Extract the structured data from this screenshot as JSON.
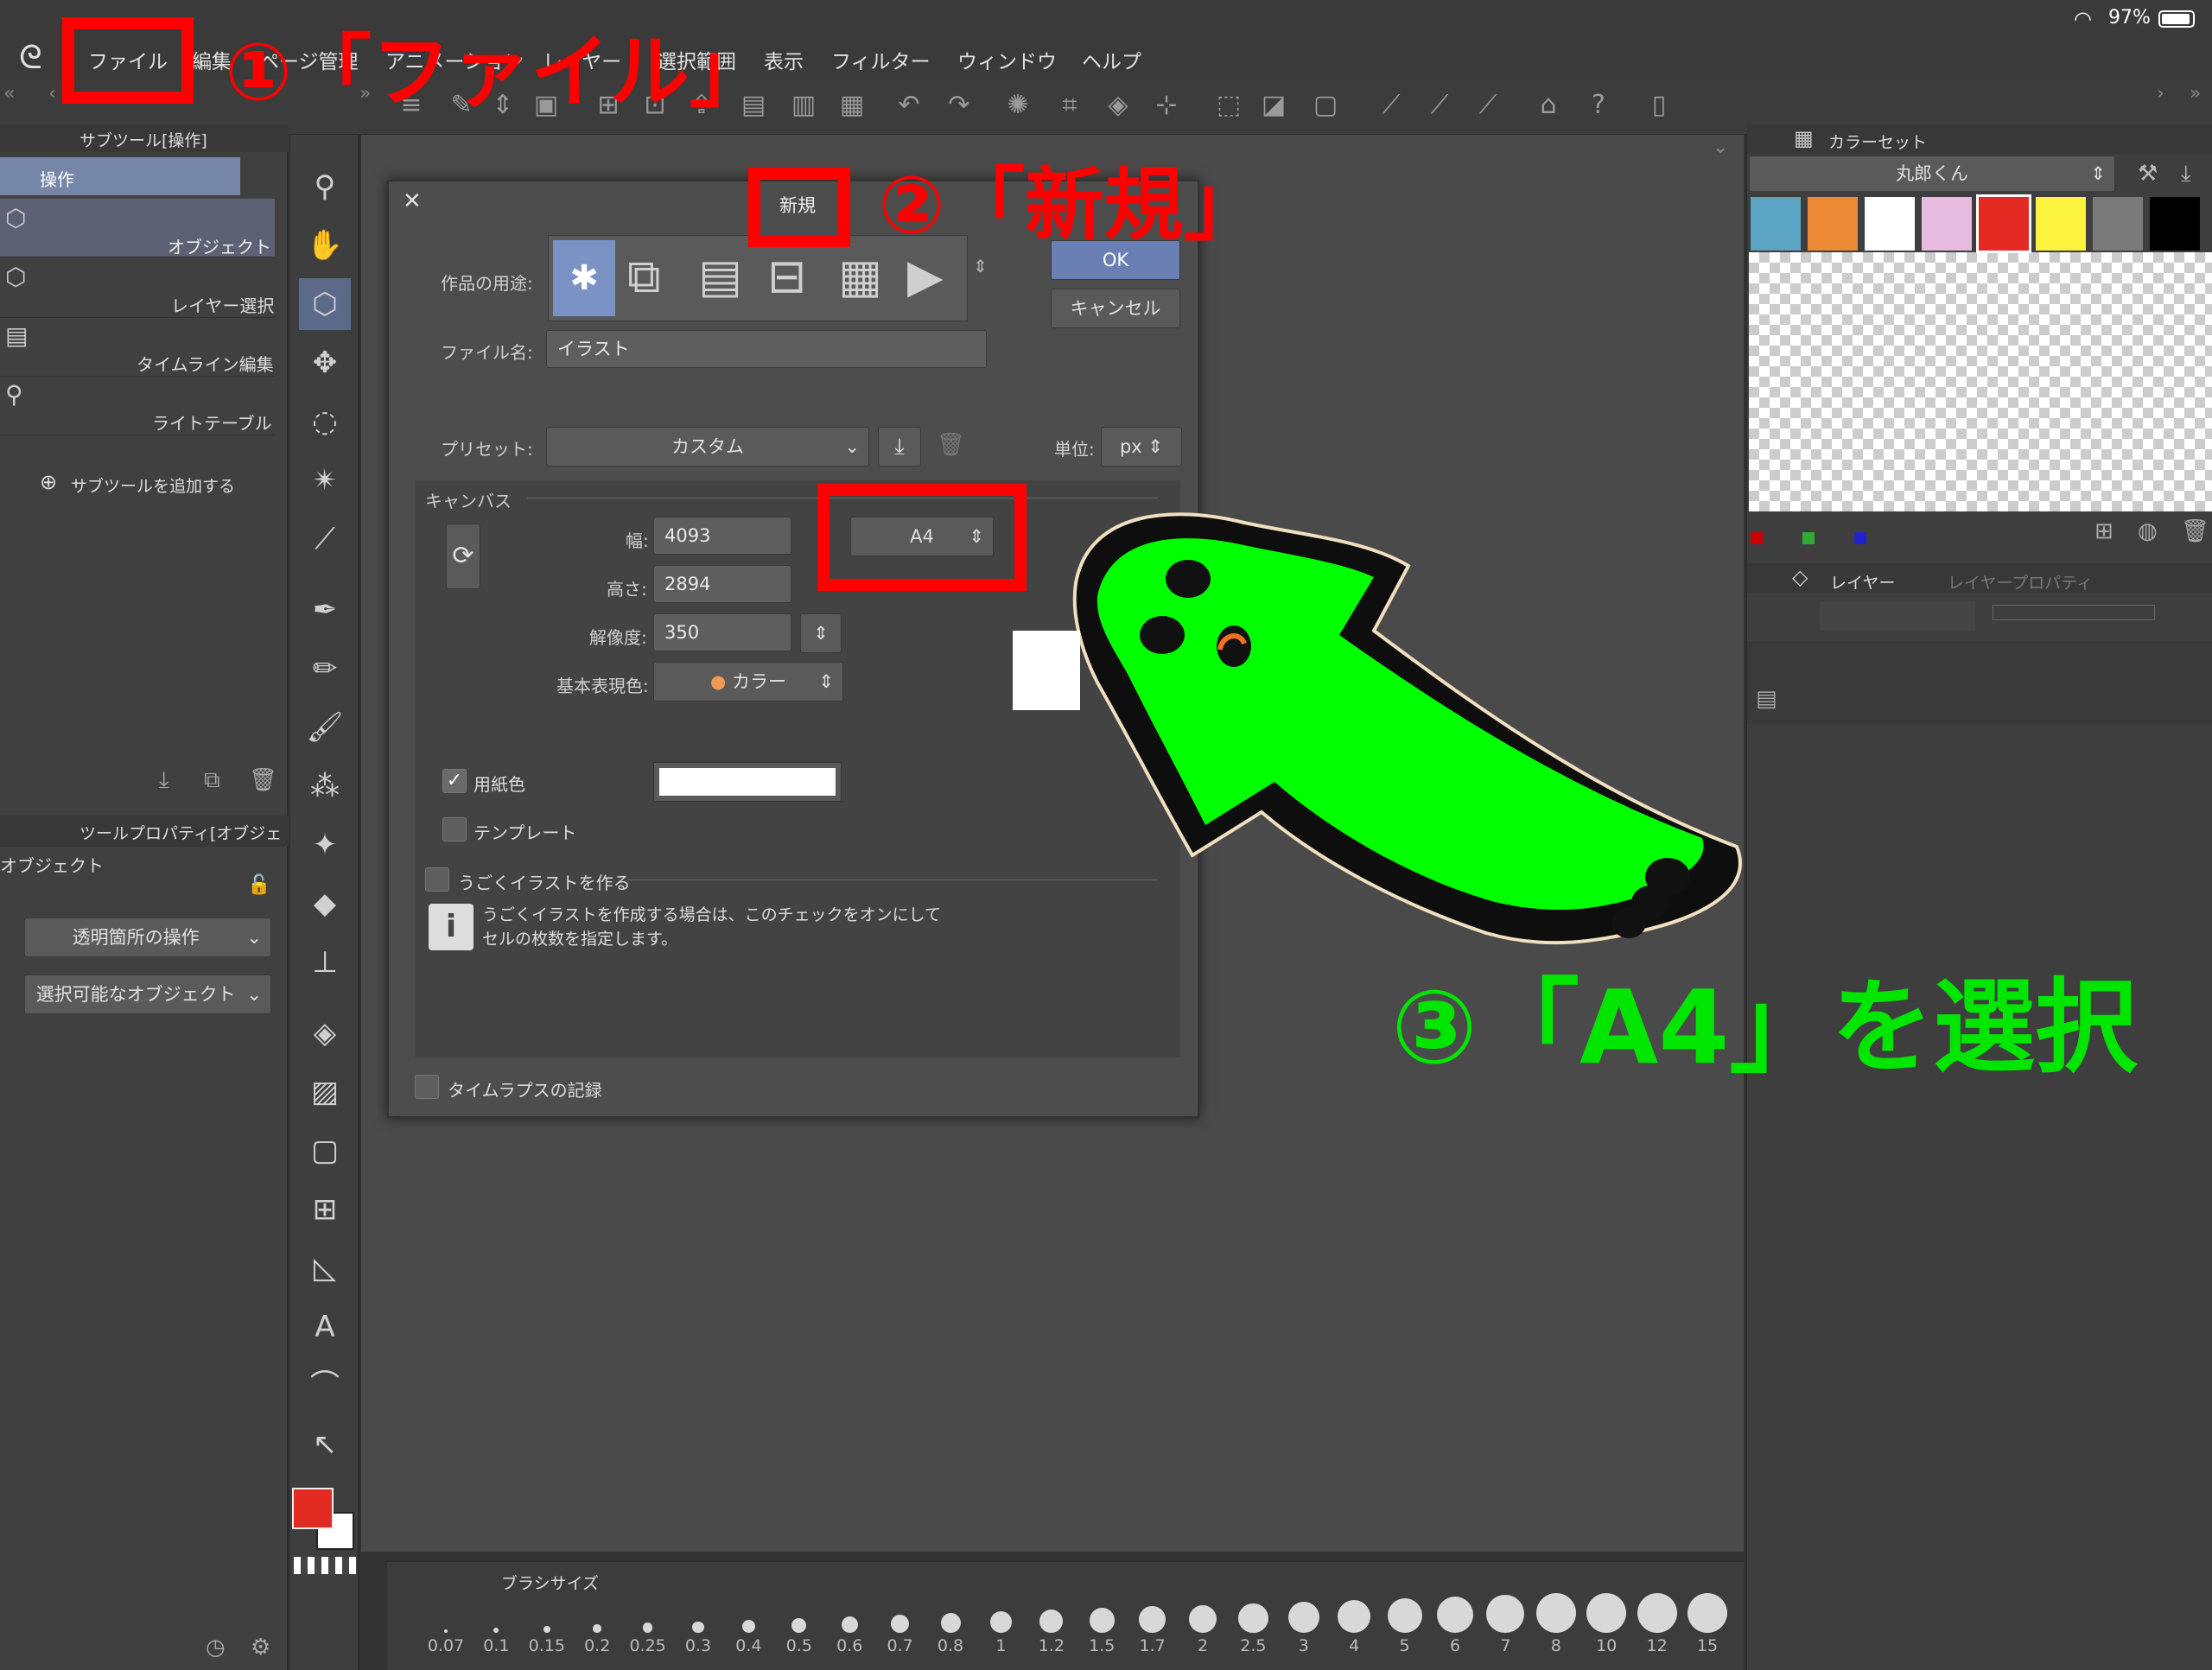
{
  "status": {
    "battery": "97%"
  },
  "menu": [
    "ファイル",
    "編集",
    "ページ管理",
    "アニメーション",
    "レイヤー",
    "選択範囲",
    "表示",
    "フィルター",
    "ウィンドウ",
    "ヘルプ"
  ],
  "subtool": {
    "title": "サブツール[操作]",
    "group": "操作",
    "items": [
      "オブジェクト",
      "レイヤー選択",
      "タイムライン編集",
      "ライトテーブル"
    ],
    "add": "サブツールを追加する"
  },
  "toolprop": {
    "title": "ツールプロパティ[オブジェ",
    "name": "オブジェクト",
    "dropdown1": "透明箇所の操作",
    "dropdown2": "選択可能なオブジェクト"
  },
  "dialog": {
    "title": "新規",
    "purpose_label": "作品の用途:",
    "ok": "OK",
    "cancel": "キャンセル",
    "filename_label": "ファイル名:",
    "filename": "イラスト",
    "preset_label": "プリセット:",
    "preset": "カスタム",
    "unit_label": "単位:",
    "unit": "px",
    "canvas_section": "キャンバス",
    "width_label": "幅:",
    "width": "4093",
    "height_label": "高さ:",
    "height": "2894",
    "size": "A4",
    "resolution_label": "解像度:",
    "resolution": "350",
    "color_label": "基本表現色:",
    "color": "カラー",
    "paper_label": "用紙色",
    "template_label": "テンプレート",
    "anim_label": "うごくイラストを作る",
    "anim_info_1": "うごくイラストを作成する場合は、このチェックをオンにして",
    "anim_info_2": "セルの枚数を指定します。",
    "timelapse_label": "タイムラプスの記録"
  },
  "colorset": {
    "title": "カラーセット",
    "name": "丸郎くん",
    "swatches": [
      "#5ba4c4",
      "#ed8a35",
      "#ffffff",
      "#e6bde1",
      "#e32b24",
      "#fcf33e",
      "#7a7a7a",
      "#000000"
    ]
  },
  "layer": {
    "title": "レイヤー",
    "prop": "レイヤープロパティ"
  },
  "brush": {
    "title": "ブラシサイズ",
    "sizes": [
      "0.07",
      "0.1",
      "0.15",
      "0.2",
      "0.25",
      "0.3",
      "0.4",
      "0.5",
      "0.6",
      "0.7",
      "0.8",
      "1",
      "1.2",
      "1.5",
      "1.7",
      "2",
      "2.5",
      "3",
      "4",
      "5",
      "6",
      "7",
      "8",
      "10",
      "12",
      "15"
    ]
  },
  "annotations": {
    "step1": "①「ファイル」",
    "step2": "②「新規」",
    "step3": "③「A4」を選択"
  },
  "colors": {
    "accent": "#ff0000",
    "annotation_green": "#00e600",
    "main_color": "#e32b24"
  }
}
